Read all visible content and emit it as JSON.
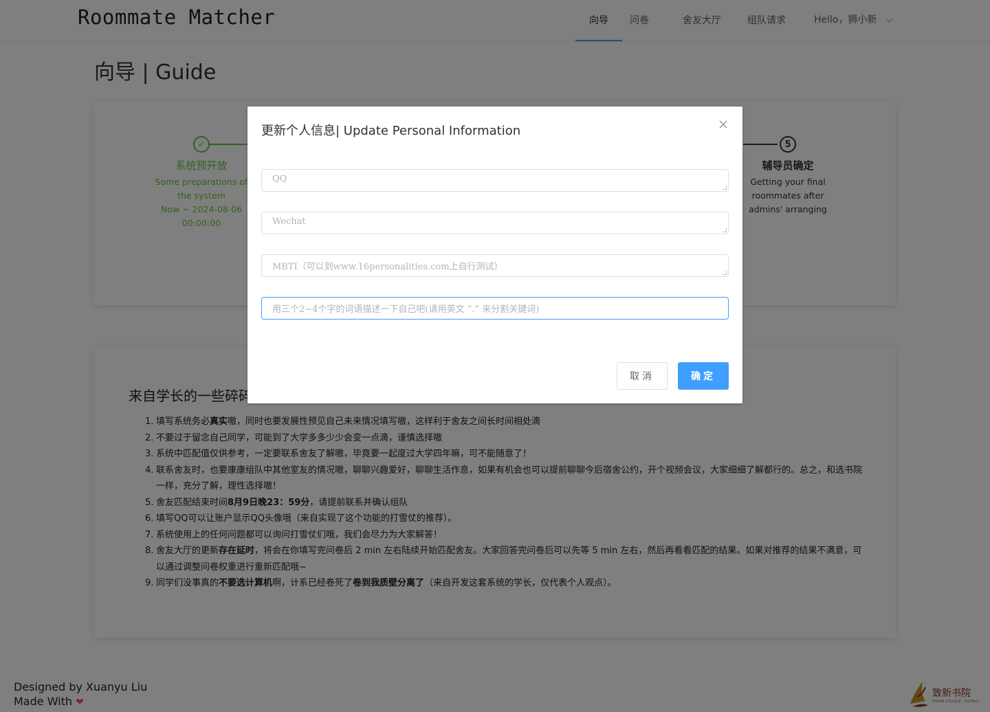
{
  "header": {
    "brand": "Roommate Matcher",
    "nav": [
      {
        "label": "向导",
        "active": true
      },
      {
        "label": "问卷",
        "active": false
      },
      {
        "label": "舍友大厅",
        "active": false
      },
      {
        "label": "组队请求",
        "active": false
      }
    ],
    "user_label": "Hello，狮小新"
  },
  "page_title": "向导 | Guide",
  "steps": {
    "first": {
      "number": "✓",
      "status": "done",
      "title": "系统预开放",
      "desc_1": "Some preparations of",
      "desc_2": "the system",
      "desc_3": "Now ~ 2024-08-06",
      "desc_4": "00:00:00"
    },
    "last": {
      "number": "5",
      "status": "wait",
      "title": "辅导员确定",
      "desc_1": "Getting your final",
      "desc_2": "roommates after",
      "desc_3": "admins' arranging"
    }
  },
  "tips": {
    "title": "来自学长的一些碎碎念",
    "items": [
      {
        "n": "1.",
        "a": "填写系统务必",
        "b": "真实",
        "c": "嗷，同时也要发展性预见自己未来情况填写嗷，这样利于舍友之间长时间相处滴"
      },
      {
        "n": "2.",
        "a": "不要过于留念自己同学，可能到了大学多多少少会变一点滴，谨慎选择嗷",
        "b": "",
        "c": ""
      },
      {
        "n": "3.",
        "a": "系统中匹配值仅供参考，一定要联系舍友了解嗷，毕竟要一起度过大学四年嘛，可不能随意了！",
        "b": "",
        "c": ""
      },
      {
        "n": "4.",
        "a": "联系舍友时，也要康康组队中其他室友的情况嗷，聊聊兴趣爱好，聊聊生活作息，如果有机会也可以提前聊聊今后宿舍公约，开个视频会议，大家细细了解都行的。总之，和选书院一样，充分了解，理性选择嗷！",
        "b": "",
        "c": ""
      },
      {
        "n": "5.",
        "a": "舍友匹配结束时间",
        "b": "8月9日晚23：59分",
        "c": "，请提前联系并确认组队"
      },
      {
        "n": "6.",
        "a": "填写QQ可以让账户显示QQ头像哦（来自实现了这个功能的打雪仗的推荐）。",
        "b": "",
        "c": ""
      },
      {
        "n": "7.",
        "a": "系统使用上的任何问题都可以询问打雪仗们哦，我们会尽力为大家解答！",
        "b": "",
        "c": ""
      },
      {
        "n": "8.",
        "a": "舍友大厅的更新",
        "b": "存在延时",
        "c": "，将会在你填写完问卷后 2 min 左右陆续开始匹配舍友。大家回答完问卷后可以先等 5 min 左右，然后再看看匹配的结果。如果对推荐的结果不满意，可以通过调整问卷权重进行重新匹配哦~"
      },
      {
        "n": "9.",
        "a": "同学们没事真的",
        "b": "不要选计算机",
        "c": "啊，计系已经卷死了",
        "d": "卷到我质壁分离了",
        "e": "（来自开发这套系统的学长，仅代表个人观点）。"
      }
    ]
  },
  "footer": {
    "line1": "Designed by Xuanyu Liu",
    "line2": "Made With",
    "logo_text": "致新书院",
    "logo_sub": "ZHIXIN COLLEGE · SUSTech"
  },
  "dialog": {
    "title": "更新个人信息| Update Personal Information",
    "fields": {
      "qq": {
        "placeholder": "QQ",
        "value": ""
      },
      "wechat": {
        "placeholder": "Wechat",
        "value": ""
      },
      "mbti": {
        "placeholder": "MBTI（可以到www.16personalities.com上自行测试）",
        "value": ""
      },
      "keywords": {
        "placeholder": "用三个2~4个字的词语描述一下自己吧(请用英文 “.” 来分割关键词)",
        "value": ""
      }
    },
    "cancel_label": "取消",
    "ok_label": "确定"
  },
  "colors": {
    "primary": "#409eff",
    "success": "#67c23a",
    "overlay": "rgba(0,0,0,0.5)"
  }
}
